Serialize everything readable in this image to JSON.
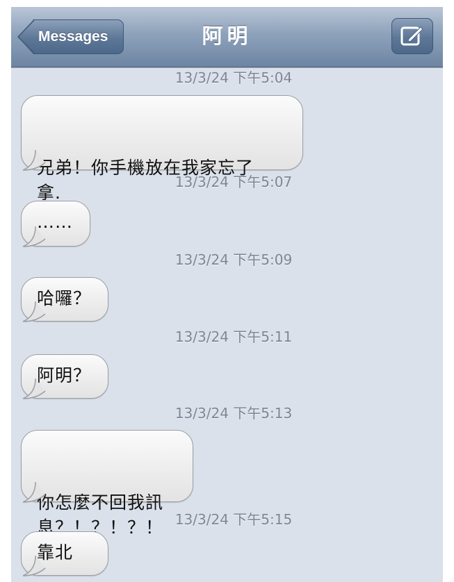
{
  "nav": {
    "back_label": "Messages",
    "title": "阿明",
    "compose_icon": "compose-icon"
  },
  "colors": {
    "nav_bar": "#7f94b0",
    "background": "#dbe1ea",
    "bubble": "#eeeeee",
    "timestamp": "#7d8595"
  },
  "messages": [
    {
      "time": "13/3/24 下午5:04",
      "text": "兄弟！你手機放在我家忘了\n拿."
    },
    {
      "time": "13/3/24 下午5:07",
      "text": "……"
    },
    {
      "time": "13/3/24 下午5:09",
      "text": "哈囉？"
    },
    {
      "time": "13/3/24 下午5:11",
      "text": "阿明？"
    },
    {
      "time": "13/3/24 下午5:13",
      "text": "你怎麼不回我訊\n息？！？！？！"
    },
    {
      "time": "13/3/24 下午5:15",
      "text": "靠北"
    }
  ]
}
